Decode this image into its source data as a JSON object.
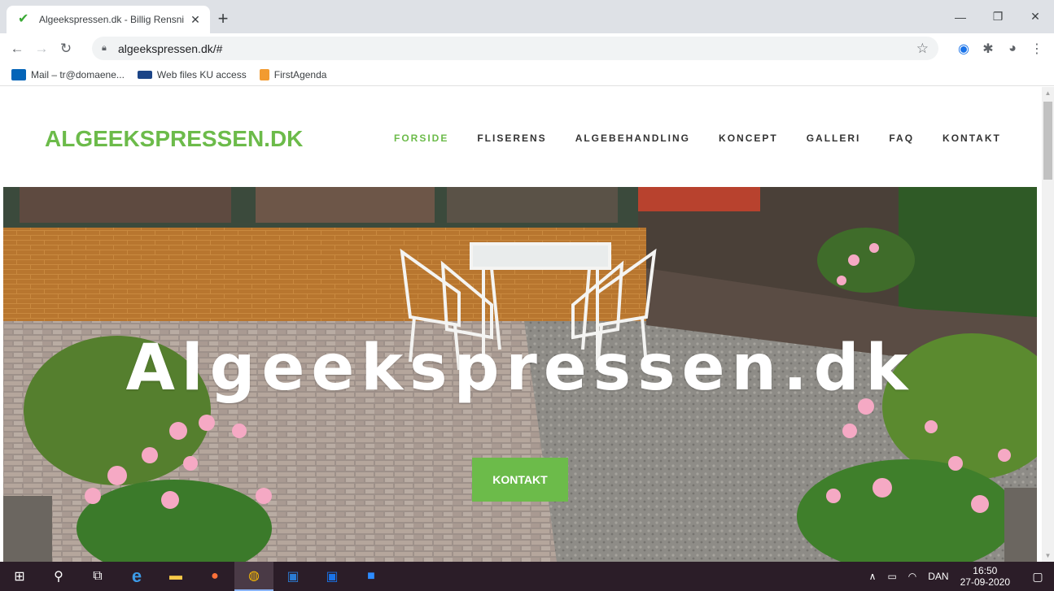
{
  "browser": {
    "tab_title": "Algeekspressen.dk - Billig Rensni",
    "url": "algeekspressen.dk/#",
    "bookmarks": [
      {
        "label": "Mail – tr@domaene...",
        "icon": "outlook-icon"
      },
      {
        "label": "Web files KU access",
        "icon": "ku-icon"
      },
      {
        "label": "FirstAgenda",
        "icon": "firstagenda-icon"
      }
    ]
  },
  "site": {
    "logo": "ALGEEKSPRESSEN.DK",
    "nav": [
      {
        "label": "FORSIDE",
        "active": true
      },
      {
        "label": "FLISERENS",
        "active": false
      },
      {
        "label": "ALGEBEHANDLING",
        "active": false
      },
      {
        "label": "KONCEPT",
        "active": false
      },
      {
        "label": "GALLERI",
        "active": false
      },
      {
        "label": "FAQ",
        "active": false
      },
      {
        "label": "KONTAKT",
        "active": false
      }
    ],
    "hero": {
      "title": "Algeekspressen.dk",
      "button": "KONTAKT"
    },
    "accent_color": "#6cbb4a"
  },
  "taskbar": {
    "apps": [
      "start-icon",
      "search-icon",
      "task-view-icon",
      "edge-icon",
      "file-explorer-icon",
      "firefox-icon",
      "chrome-icon",
      "word-icon",
      "outlook-icon",
      "zoom-icon"
    ],
    "language": "DAN",
    "time": "16:50",
    "date": "27-09-2020"
  }
}
